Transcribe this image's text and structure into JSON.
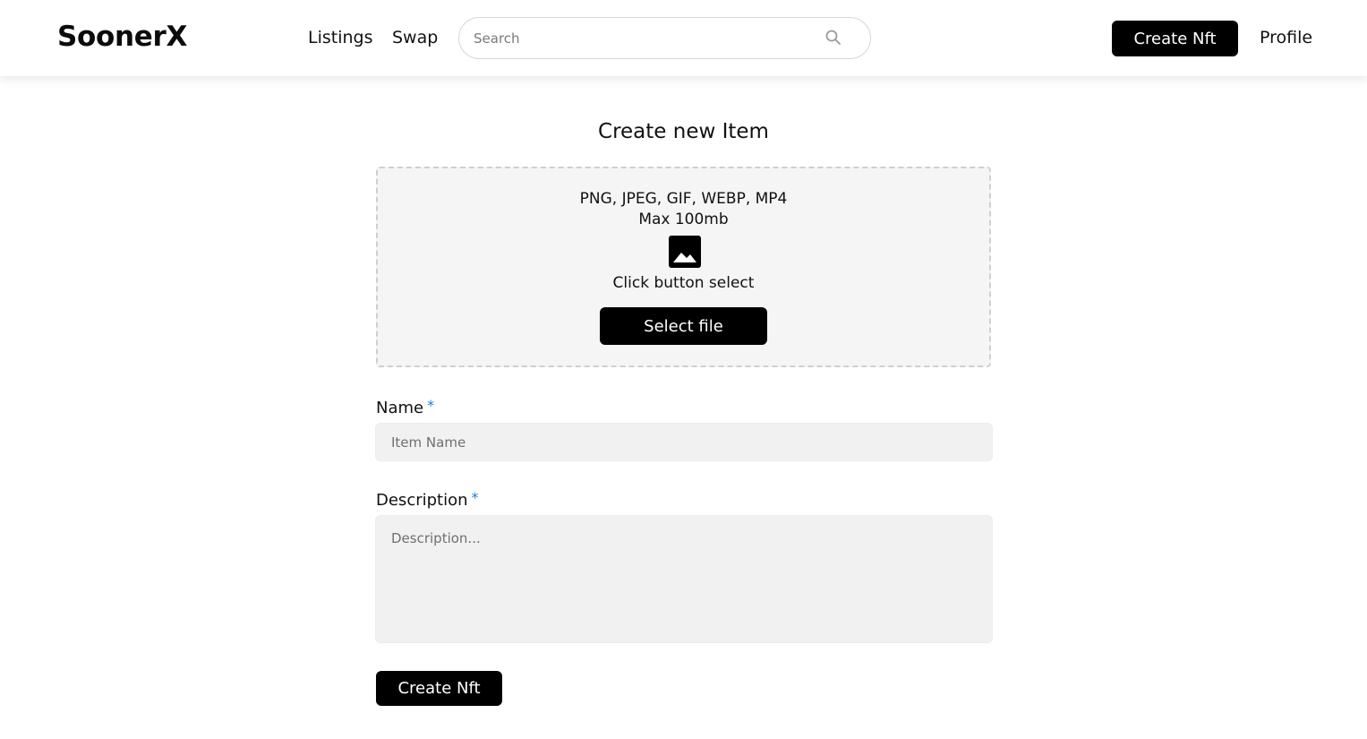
{
  "header": {
    "logo": "SoonerX",
    "nav": {
      "listings": "Listings",
      "swap": "Swap",
      "profile": "Profile"
    },
    "search": {
      "placeholder": "Search",
      "icon": "search-icon"
    },
    "create_button": "Create Nft"
  },
  "main": {
    "title": "Create new Item",
    "dropzone": {
      "formats": "PNG, JPEG, GIF, WEBP, MP4",
      "max_size": "Max 100mb",
      "icon": "image-icon",
      "hint": "Click button select",
      "select_button": "Select file"
    },
    "form": {
      "name_label": "Name",
      "name_placeholder": "Item Name",
      "description_label": "Description",
      "description_placeholder": "Description...",
      "required_marker": "*",
      "submit_button": "Create Nft"
    }
  },
  "colors": {
    "accent": "#000000",
    "required": "#1e7fd6",
    "input_bg": "#f1f1f1"
  }
}
